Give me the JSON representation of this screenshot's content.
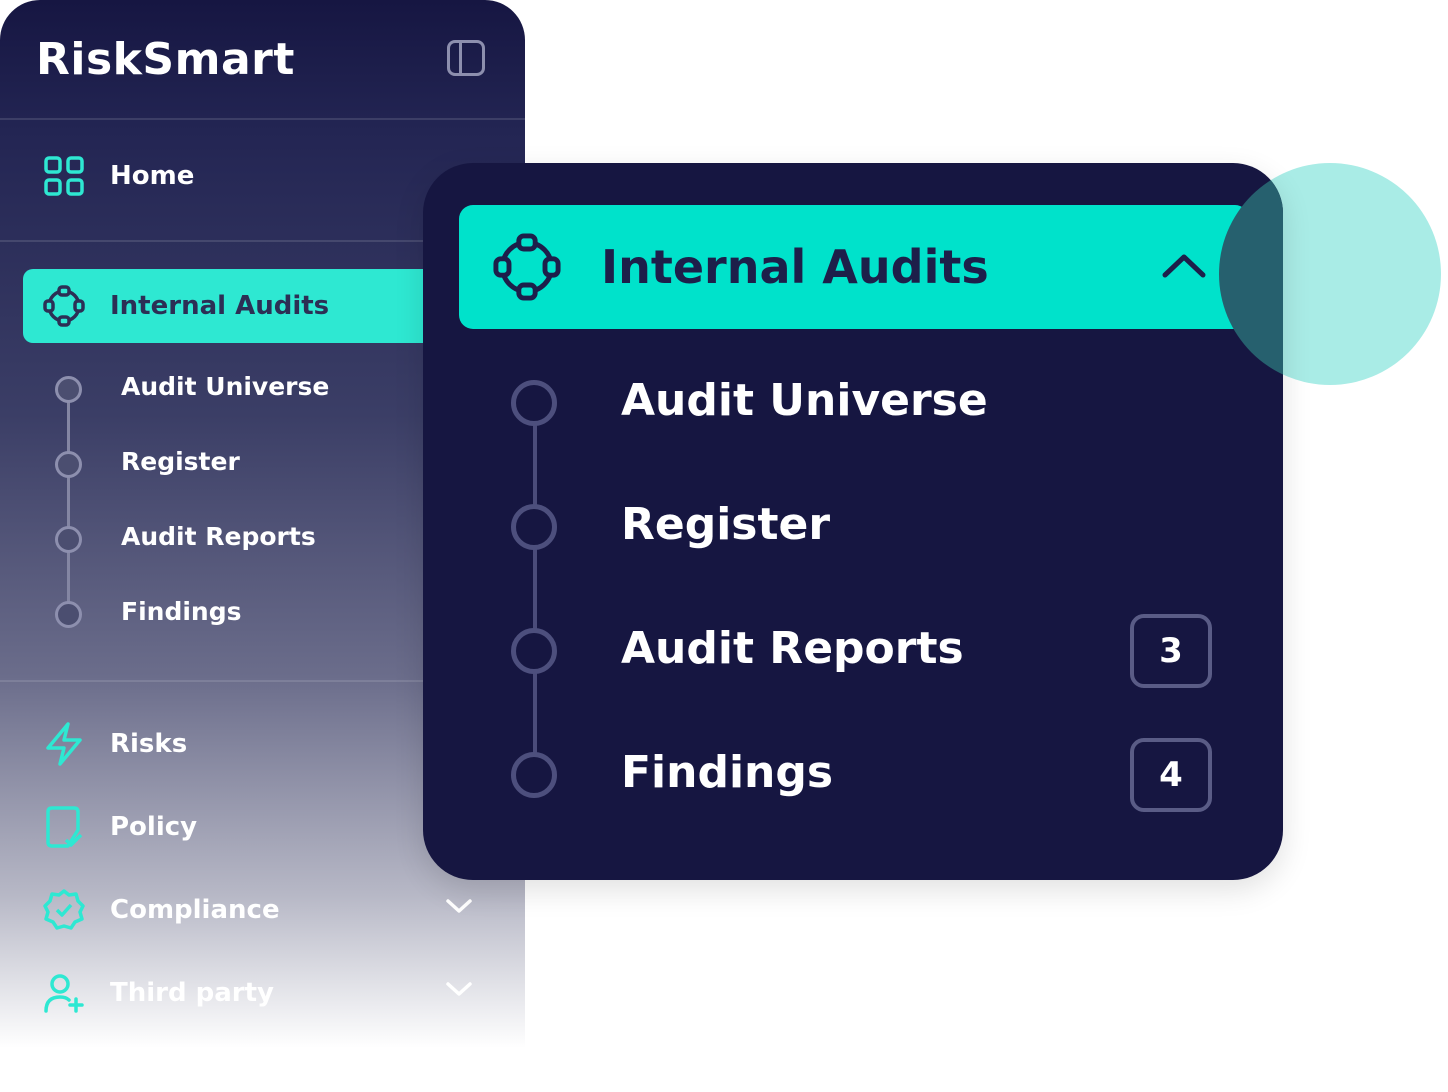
{
  "app": {
    "name": "RiskSmart"
  },
  "sidebar": {
    "home": {
      "label": "Home",
      "icon": "grid-icon"
    },
    "active_section": {
      "label": "Internal Audits",
      "icon": "audit-cycle-icon"
    },
    "sub_items": [
      {
        "label": "Audit Universe"
      },
      {
        "label": "Register"
      },
      {
        "label": "Audit Reports"
      },
      {
        "label": "Findings"
      }
    ],
    "items": [
      {
        "label": "Risks",
        "icon": "lightning-icon"
      },
      {
        "label": "Policy",
        "icon": "policy-document-icon"
      },
      {
        "label": "Compliance",
        "icon": "compliance-badge-icon"
      },
      {
        "label": "Third party",
        "icon": "third-party-icon"
      }
    ]
  },
  "zoom_card": {
    "title": "Internal Audits",
    "items": [
      {
        "label": "Audit Universe",
        "badge": ""
      },
      {
        "label": "Register",
        "badge": ""
      },
      {
        "label": "Audit Reports",
        "badge": "3"
      },
      {
        "label": "Findings",
        "badge": "4"
      }
    ]
  },
  "colors": {
    "accent": "#00e2cb",
    "navy": "#161641",
    "teal_light": "#a9ece6"
  }
}
